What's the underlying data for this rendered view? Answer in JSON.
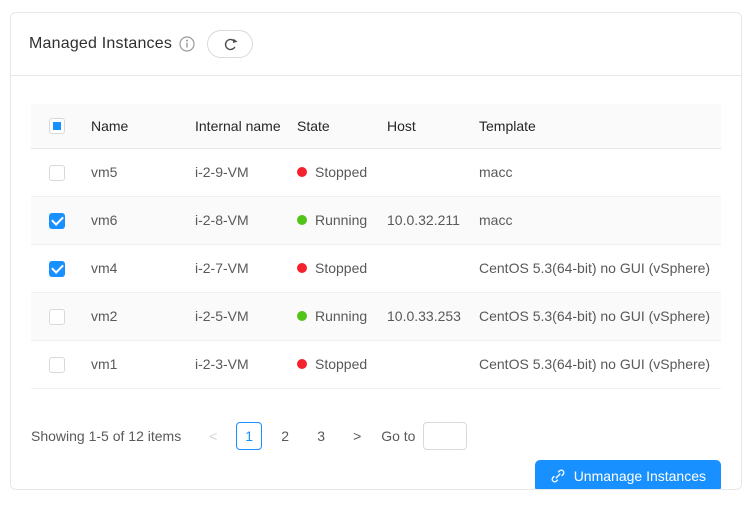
{
  "header": {
    "title": "Managed Instances",
    "info_icon": "info-circle-icon",
    "refresh_icon": "reload-icon"
  },
  "colors": {
    "primary": "#1890ff",
    "running": "#52c41a",
    "stopped": "#f5222d",
    "header_bg": "#fafafa",
    "border": "#e8e8e8"
  },
  "table": {
    "select_all_state": "indeterminate",
    "columns": [
      "Name",
      "Internal name",
      "State",
      "Host",
      "Template"
    ],
    "rows": [
      {
        "checked": false,
        "name": "vm5",
        "internal_name": "i-2-9-VM",
        "state": "Stopped",
        "state_color": "#f5222d",
        "host": "",
        "template": "macc"
      },
      {
        "checked": true,
        "name": "vm6",
        "internal_name": "i-2-8-VM",
        "state": "Running",
        "state_color": "#52c41a",
        "host": "10.0.32.211",
        "template": "macc"
      },
      {
        "checked": true,
        "name": "vm4",
        "internal_name": "i-2-7-VM",
        "state": "Stopped",
        "state_color": "#f5222d",
        "host": "",
        "template": "CentOS 5.3(64-bit) no GUI (vSphere)"
      },
      {
        "checked": false,
        "name": "vm2",
        "internal_name": "i-2-5-VM",
        "state": "Running",
        "state_color": "#52c41a",
        "host": "10.0.33.253",
        "template": "CentOS 5.3(64-bit) no GUI (vSphere)"
      },
      {
        "checked": false,
        "name": "vm1",
        "internal_name": "i-2-3-VM",
        "state": "Stopped",
        "state_color": "#f5222d",
        "host": "",
        "template": "CentOS 5.3(64-bit) no GUI (vSphere)"
      }
    ]
  },
  "pagination": {
    "summary": "Showing 1-5 of 12 items",
    "prev_symbol": "<",
    "next_symbol": ">",
    "pages": [
      "1",
      "2",
      "3"
    ],
    "active_page": "1",
    "goto_label": "Go to",
    "goto_value": ""
  },
  "actions": {
    "unmanage_label": "Unmanage Instances",
    "unmanage_icon": "disconnect-icon"
  }
}
